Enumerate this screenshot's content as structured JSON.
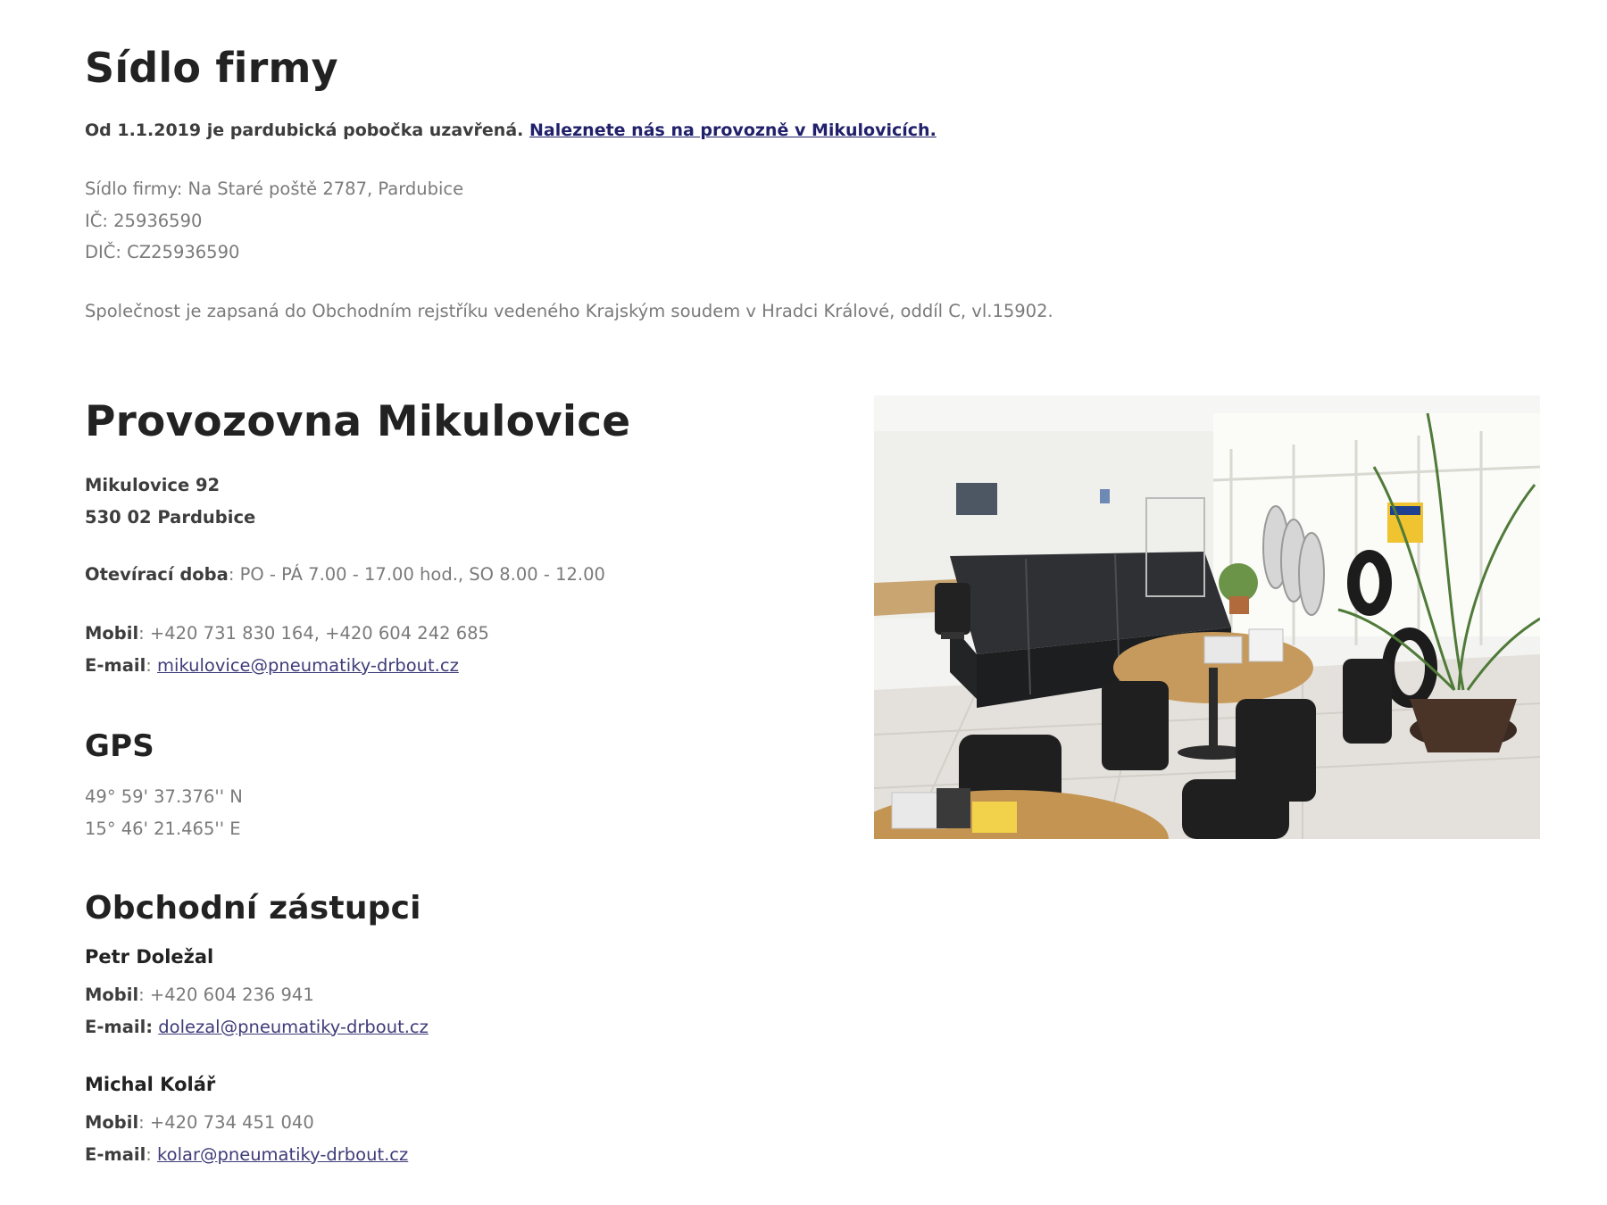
{
  "sidlo": {
    "title": "Sídlo firmy",
    "notice_text": "Od 1.1.2019 je pardubická pobočka uzavřená.",
    "notice_link": "Naleznete nás na provozně v Mikulovicích.",
    "address_line": "Sídlo firmy: Na Staré poště 2787, Pardubice",
    "ic_line": "IČ: 25936590",
    "dic_line": "DIČ: CZ25936590",
    "register_line": "Společnost je zapsaná do Obchodním rejstříku vedeného Krajským soudem v Hradci Králové, oddíl C, vl.15902."
  },
  "provozovna": {
    "title": "Provozovna Mikulovice",
    "address_1": "Mikulovice 92",
    "address_2": "530 02 Pardubice",
    "hours_label": "Otevírací doba",
    "hours_value": ": PO - PÁ  7.00 - 17.00 hod., SO 8.00 - 12.00",
    "mobile_label": "Mobil",
    "mobile_value": ": +420 731 830 164, +420 604 242 685",
    "email_label": "E-mail",
    "email_sep": ": ",
    "email_value": "mikulovice@pneumatiky-drbout.cz"
  },
  "gps": {
    "title": "GPS",
    "lat": "49° 59' 37.376'' N",
    "lon": "15° 46' 21.465'' E"
  },
  "zastupci": {
    "title": "Obchodní zástupci",
    "people": [
      {
        "name": "Petr Doležal",
        "mobile_label": "Mobil",
        "mobile_value": ": +420 604 236 941",
        "email_label": "E-mail:",
        "email_sep": " ",
        "email_value": "dolezal@pneumatiky-drbout.cz"
      },
      {
        "name": "Michal Kolář",
        "mobile_label": "Mobil",
        "mobile_value": ": +420 734 451 040",
        "email_label": "E-mail",
        "email_sep": ": ",
        "email_value": "kolar@pneumatiky-drbout.cz"
      }
    ]
  },
  "colors": {
    "heading": "#222222",
    "body_text": "#7a7a7a",
    "link": "#21206b",
    "email_link": "#3e3c79"
  }
}
